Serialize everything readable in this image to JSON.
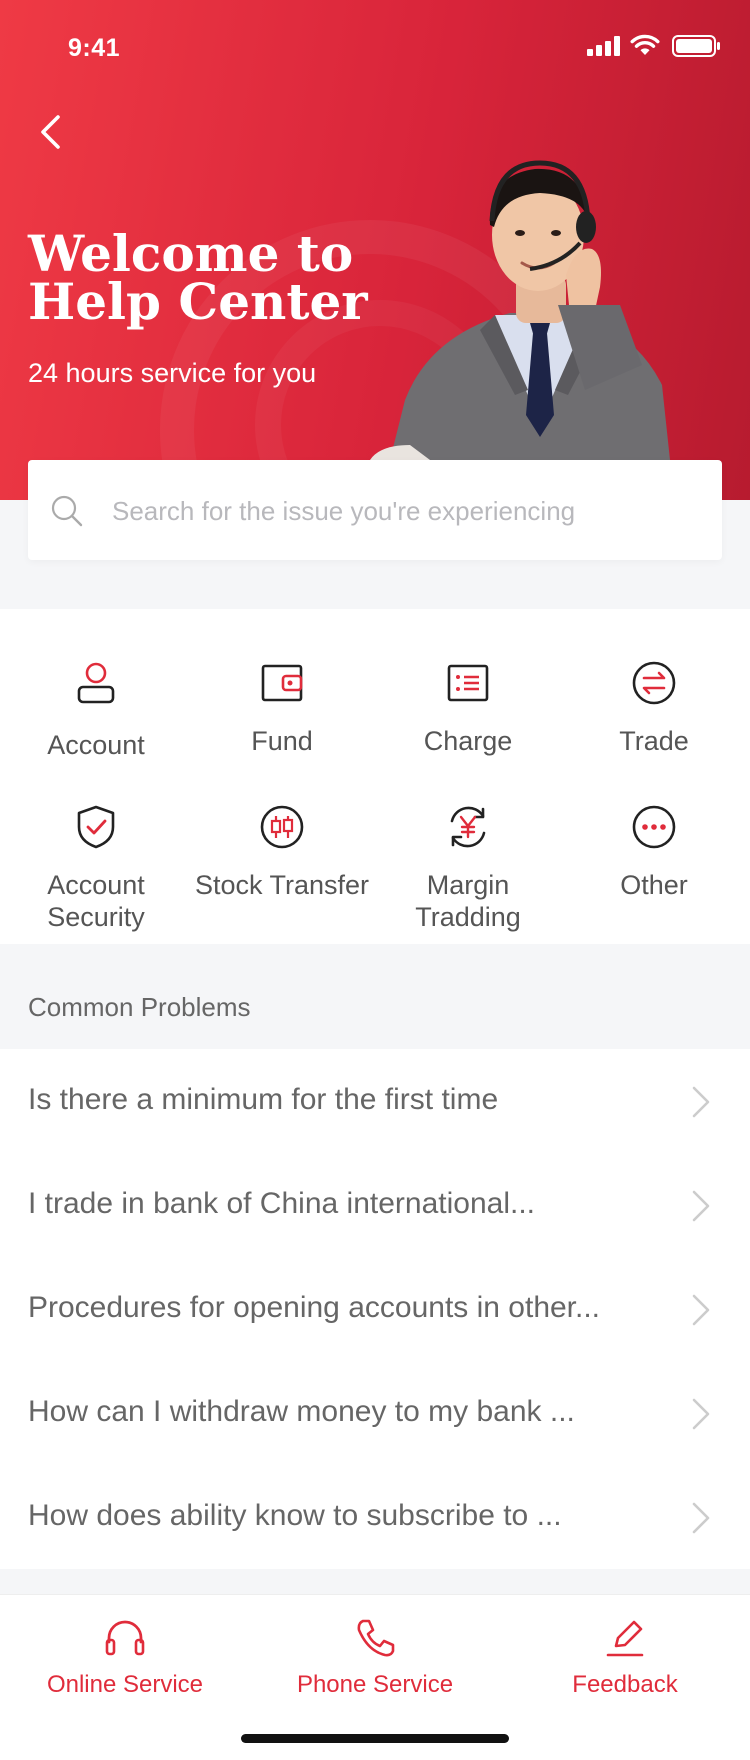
{
  "status_bar": {
    "time": "9:41"
  },
  "header": {
    "title": "Welcome to Help Center",
    "subtitle": "24 hours service for you"
  },
  "search": {
    "placeholder": "Search for the issue you're experiencing"
  },
  "categories": [
    {
      "label": "Account",
      "icon": "user-icon"
    },
    {
      "label": "Fund",
      "icon": "wallet-icon"
    },
    {
      "label": "Charge",
      "icon": "list-icon"
    },
    {
      "label": "Trade",
      "icon": "exchange-icon"
    },
    {
      "label": "Account\nSecurity",
      "icon": "shield-check-icon"
    },
    {
      "label": "Stock Transfer",
      "icon": "candlestick-icon"
    },
    {
      "label": "Margin\nTradding",
      "icon": "yen-refresh-icon"
    },
    {
      "label": "Other",
      "icon": "more-icon"
    }
  ],
  "common_problems": {
    "heading": "Common Problems",
    "items": [
      "Is there a minimum for the first time",
      "I trade in bank of China international...",
      "Procedures for opening accounts in other...",
      "How can I withdraw money to my bank ...",
      "How does ability know to subscribe to ..."
    ]
  },
  "bottom_nav": [
    {
      "label": "Online Service",
      "icon": "headset-icon"
    },
    {
      "label": "Phone Service",
      "icon": "phone-icon"
    },
    {
      "label": "Feedback",
      "icon": "edit-icon"
    }
  ],
  "colors": {
    "brand": "#e02c3b",
    "hero_start": "#ef3a45",
    "hero_end": "#b71b2f"
  }
}
